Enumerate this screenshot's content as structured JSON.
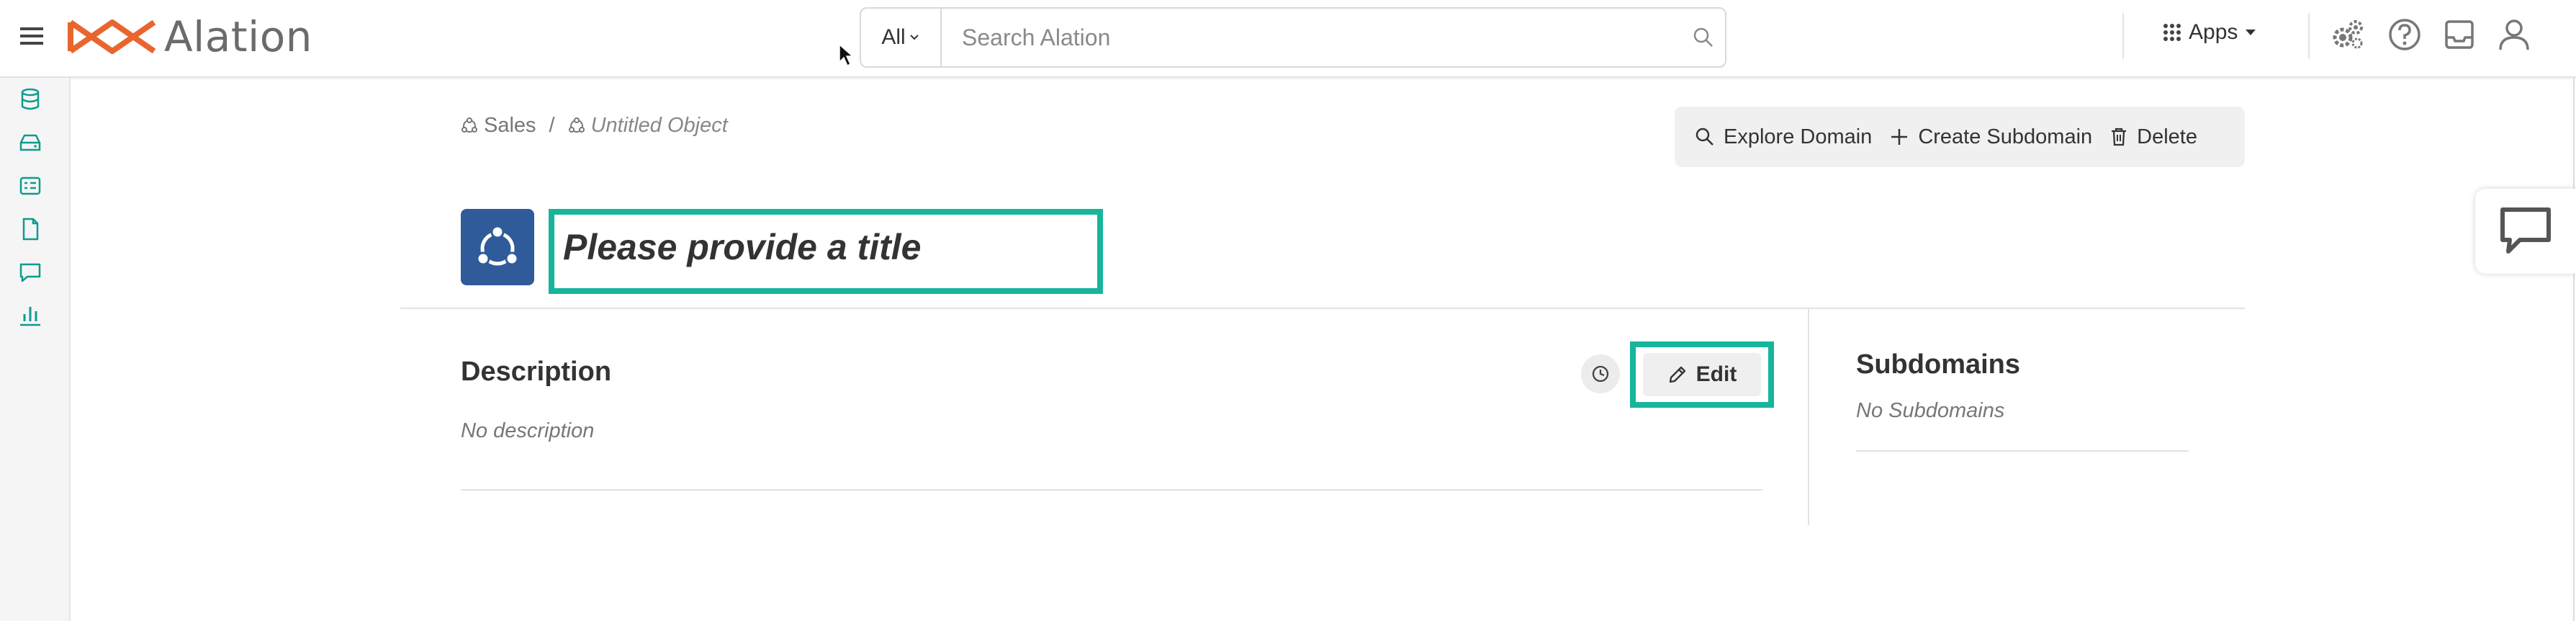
{
  "app": {
    "name": "Alation"
  },
  "colors": {
    "accent": "#17b59b",
    "brand": "#e8662e",
    "domain_tile": "#2f5b9a",
    "nav_icon": "#0f9b8e"
  },
  "search": {
    "scope": "All",
    "placeholder": "Search Alation"
  },
  "header": {
    "apps_label": "Apps"
  },
  "leftnav": {
    "icons": [
      "database-icon",
      "storage-icon",
      "catalog-icon",
      "document-icon",
      "conversation-icon",
      "bar-chart-icon"
    ]
  },
  "breadcrumb": [
    {
      "label": "Sales",
      "icon": "domain-icon"
    },
    {
      "label": "Untitled Object",
      "icon": "domain-icon"
    }
  ],
  "toolbar": {
    "explore_label": "Explore Domain",
    "create_label": "Create Subdomain",
    "delete_label": "Delete"
  },
  "title": {
    "placeholder": "Please provide a title"
  },
  "description": {
    "heading": "Description",
    "value": "No description",
    "edit_label": "Edit"
  },
  "subdomains": {
    "heading": "Subdomains",
    "value": "No Subdomains"
  }
}
